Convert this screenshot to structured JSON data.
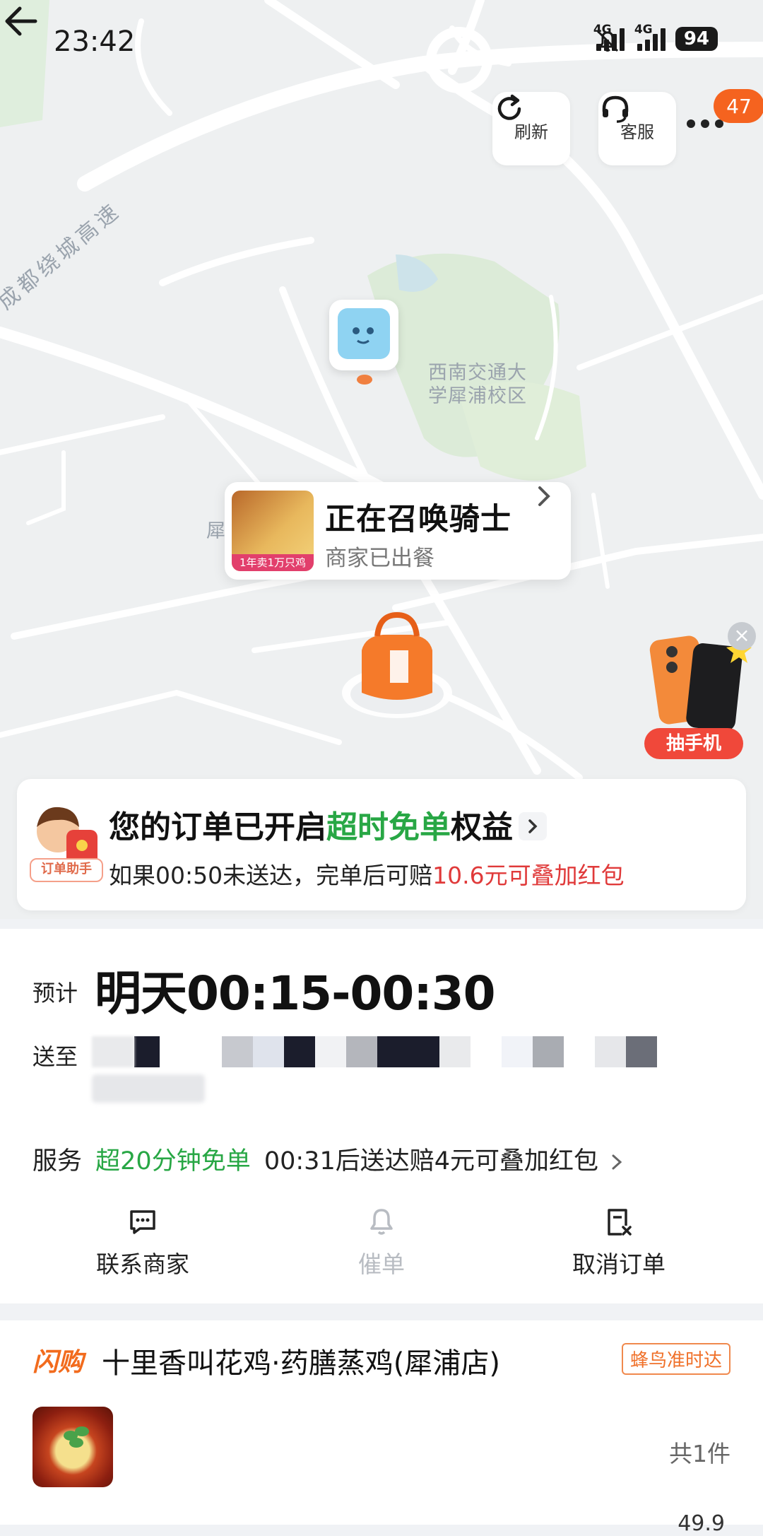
{
  "status_bar": {
    "time": "23:42",
    "network_1": "4G",
    "network_2": "4G",
    "battery": "94"
  },
  "top_bar": {
    "refresh_label": "刷新",
    "service_label": "客服",
    "notification_count": "47"
  },
  "map": {
    "road_label": "成都绕城高速",
    "campus_label_line1": "西南交通大",
    "campus_label_line2": "学犀浦校区",
    "partial_label": "犀"
  },
  "rider_popup": {
    "title": "正在召唤骑士",
    "subtitle": "商家已出餐",
    "thumb_ribbon": "1年卖1万只鸡"
  },
  "float_promo": {
    "label": "抽手机",
    "close": "×"
  },
  "guarantee": {
    "assistant_label": "订单助手",
    "title_prefix": "您的订单已开启",
    "title_highlight": "超时免单",
    "title_suffix": "权益",
    "sub_prefix": "如果00:50未送达，完单后可赔",
    "sub_highlight": "10.6元可叠加红包"
  },
  "order_info": {
    "eta_label": "预计",
    "eta_value": "明天00:15-00:30",
    "address_label": "送至",
    "service_label": "服务",
    "service_highlight": "超20分钟免单",
    "service_detail": "00:31后送达赔4元可叠加红包"
  },
  "actions": [
    {
      "label": "联系商家",
      "enabled": true
    },
    {
      "label": "催单",
      "enabled": false
    },
    {
      "label": "取消订单",
      "enabled": true
    }
  ],
  "store": {
    "flash_tag": "闪购",
    "name": "十里香叫花鸡·药膳蒸鸡(犀浦店)",
    "delivery_tag": "蜂鸟准时达",
    "item_count": "共1件",
    "cut_price": "49.9"
  },
  "colors": {
    "accent_orange": "#f26b1d",
    "green": "#28a745",
    "red": "#e03a3a",
    "badge": "#f5631f"
  }
}
